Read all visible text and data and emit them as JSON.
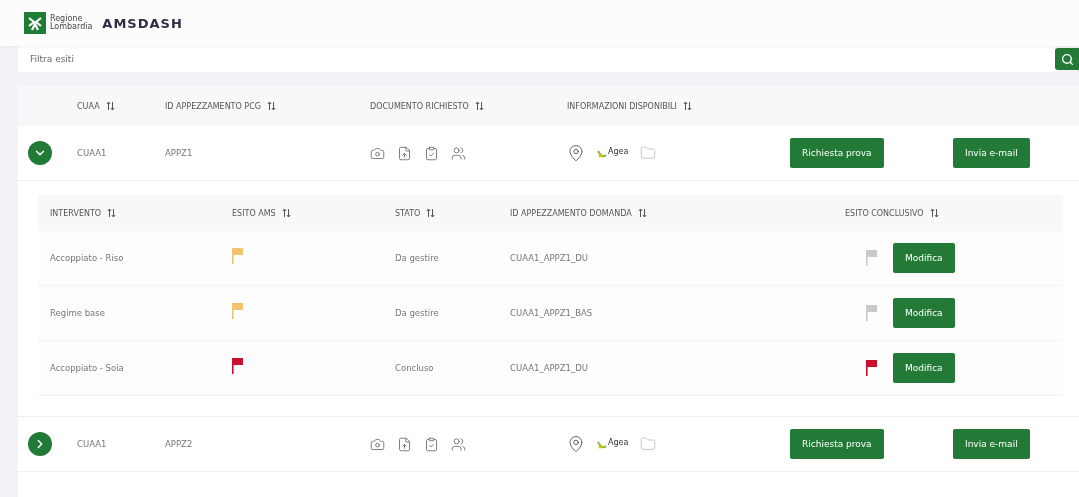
{
  "header": {
    "logo_lines": [
      "Regione",
      "Lombardia"
    ],
    "title": "AMSDASH"
  },
  "filter": {
    "placeholder": "Filtra esiti"
  },
  "table": {
    "columns": [
      "CUAA",
      "ID APPEZZAMENTO PCG",
      "DOCUMENTO RICHIESTO",
      "INFORMAZIONI DISPONIBILI"
    ],
    "rows": [
      {
        "cuaa": "CUAA1",
        "id": "APPZ1",
        "agea": "Agea",
        "expanded": true,
        "actions": [
          "Richiesta prova",
          "Invia e-mail"
        ],
        "detail": {
          "columns": [
            "INTERVENTO",
            "ESITO AMS",
            "STATO",
            "ID APPEZZAMENTO DOMANDA",
            "ESITO CONCLUSIVO"
          ],
          "rows": [
            {
              "intervento": "Accoppiato - Riso",
              "esito_ams": {
                "color": "#f2c46e"
              },
              "stato": "Da gestire",
              "id_domanda": "CUAA1_APPZ1_DU",
              "esito_conclusivo": {
                "color": "#c9c9c9"
              },
              "action": "Modifica"
            },
            {
              "intervento": "Regime base",
              "esito_ams": {
                "color": "#f2c46e"
              },
              "stato": "Da gestire",
              "id_domanda": "CUAA1_APPZ1_BAS",
              "esito_conclusivo": {
                "color": "#c9c9c9"
              },
              "action": "Modifica"
            },
            {
              "intervento": "Accoppiato - Soia",
              "esito_ams": {
                "color": "#c8102e"
              },
              "stato": "Concluso",
              "id_domanda": "CUAA1_APPZ1_DU",
              "esito_conclusivo": {
                "color": "#c8102e"
              },
              "action": "Modifica"
            }
          ]
        }
      },
      {
        "cuaa": "CUAA1",
        "id": "APPZ2",
        "agea": "Agea",
        "expanded": false,
        "actions": [
          "Richiesta prova",
          "Invia e-mail"
        ]
      }
    ]
  }
}
